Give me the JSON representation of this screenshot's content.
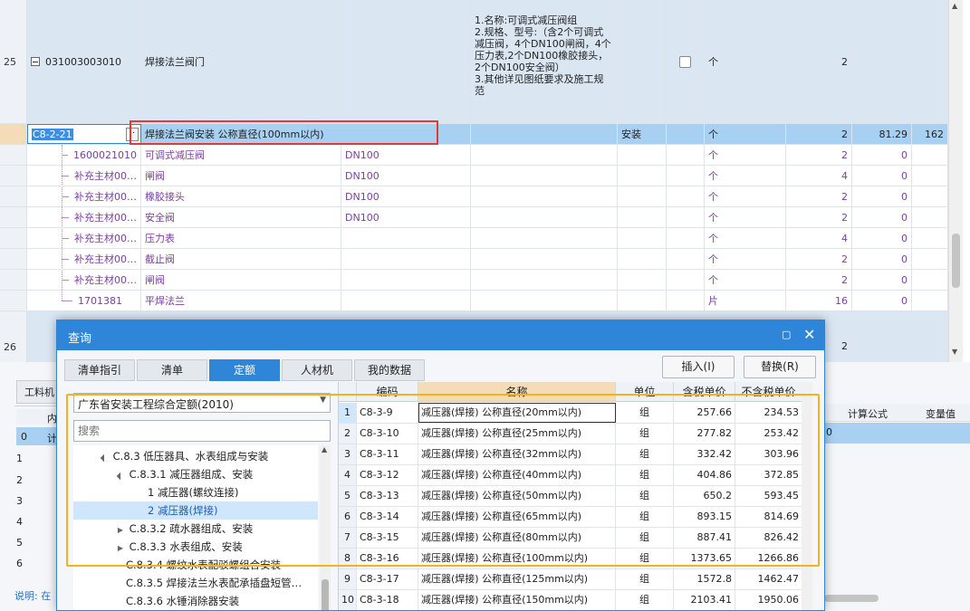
{
  "background": {
    "row25": {
      "no": "25",
      "code": "031003003010",
      "name": "焊接法兰阀门",
      "desc": "1.名称:可调式减压阀组\n2.规格、型号:（含2个可调式减压阀，4个DN100闸阀，4个压力表,2个DN100橡胶接头，2个DN100安全阀）\n3.其他详见图纸要求及施工规范",
      "unit": "个",
      "qty": "2"
    },
    "quota_row": {
      "code": "C8-2-21",
      "name": "焊接法兰阀安装 公称直径(100mm以内)",
      "type": "安装",
      "unit": "个",
      "qty": "2",
      "price": "81.29",
      "total": "162"
    },
    "materials": [
      {
        "code": "1600021010",
        "name": "可调式减压阀",
        "spec": "DN100",
        "unit": "个",
        "qty": "2",
        "v": "0"
      },
      {
        "code": "补充主材00…",
        "name": "闸阀",
        "spec": "DN100",
        "unit": "个",
        "qty": "4",
        "v": "0"
      },
      {
        "code": "补充主材00…",
        "name": "橡胶接头",
        "spec": "DN100",
        "unit": "个",
        "qty": "2",
        "v": "0"
      },
      {
        "code": "补充主材00…",
        "name": "安全阀",
        "spec": "DN100",
        "unit": "个",
        "qty": "2",
        "v": "0"
      },
      {
        "code": "补充主材00…",
        "name": "压力表",
        "spec": "",
        "unit": "个",
        "qty": "4",
        "v": "0"
      },
      {
        "code": "补充主材00…",
        "name": "截止阀",
        "spec": "",
        "unit": "个",
        "qty": "2",
        "v": "0"
      },
      {
        "code": "补充主材00…",
        "name": "闸阀",
        "spec": "",
        "unit": "个",
        "qty": "2",
        "v": "0"
      },
      {
        "code": "1701381",
        "name": "平焊法兰",
        "spec": "",
        "unit": "片",
        "qty": "16",
        "v": "0"
      }
    ],
    "row26": {
      "no": "26",
      "qty": "2"
    },
    "lower": {
      "tab1": "工料机",
      "row_labels": [
        "0",
        "1",
        "2",
        "3",
        "4",
        "5",
        "6"
      ],
      "row0_text": "计",
      "col_head": "内",
      "right_headers": [
        "计算公式",
        "变量值"
      ],
      "right_value": "0",
      "explain": "说明: 在"
    }
  },
  "dialog": {
    "title": "查询",
    "tabs": [
      "清单指引",
      "清单",
      "定额",
      "人材机",
      "我的数据"
    ],
    "active_tab": "定额",
    "insert_button": "插入(I)",
    "replace_button": "替换(R)",
    "library": "广东省安装工程综合定额(2010)",
    "search_placeholder": "搜索",
    "tree": [
      {
        "label": "C.8.3 低压器具、水表组成与安装",
        "toggle": "▲",
        "level": 0
      },
      {
        "label": "C.8.3.1 减压器组成、安装",
        "toggle": "▲",
        "level": 1
      },
      {
        "label": "1 减压器(螺纹连接)",
        "toggle": "",
        "level": 2
      },
      {
        "label": "2 减压器(焊接)",
        "toggle": "",
        "level": 2,
        "selected": true
      },
      {
        "label": "C.8.3.2 疏水器组成、安装",
        "toggle": "▶",
        "level": 1
      },
      {
        "label": "C.8.3.3 水表组成、安装",
        "toggle": "▶",
        "level": 1
      },
      {
        "label": "C.8.3.4 螺纹水表配驳螺组合安装",
        "toggle": "",
        "level": 1
      },
      {
        "label": "C.8.3.5 焊接法兰水表配承插盘短管…",
        "toggle": "",
        "level": 1
      },
      {
        "label": "C.8.3.6 水锤消除器安装",
        "toggle": "",
        "level": 1
      }
    ],
    "table": {
      "headers": [
        "编码",
        "名称",
        "单位",
        "含税单价",
        "不含税单价"
      ],
      "rows": [
        {
          "no": "1",
          "code": "C8-3-9",
          "name": "减压器(焊接) 公称直径(20mm以内)",
          "unit": "组",
          "tax": "257.66",
          "notax": "234.53"
        },
        {
          "no": "2",
          "code": "C8-3-10",
          "name": "减压器(焊接) 公称直径(25mm以内)",
          "unit": "组",
          "tax": "277.82",
          "notax": "253.42"
        },
        {
          "no": "3",
          "code": "C8-3-11",
          "name": "减压器(焊接) 公称直径(32mm以内)",
          "unit": "组",
          "tax": "332.42",
          "notax": "303.96"
        },
        {
          "no": "4",
          "code": "C8-3-12",
          "name": "减压器(焊接) 公称直径(40mm以内)",
          "unit": "组",
          "tax": "404.86",
          "notax": "372.85"
        },
        {
          "no": "5",
          "code": "C8-3-13",
          "name": "减压器(焊接) 公称直径(50mm以内)",
          "unit": "组",
          "tax": "650.2",
          "notax": "593.45"
        },
        {
          "no": "6",
          "code": "C8-3-14",
          "name": "减压器(焊接) 公称直径(65mm以内)",
          "unit": "组",
          "tax": "893.15",
          "notax": "814.69"
        },
        {
          "no": "7",
          "code": "C8-3-15",
          "name": "减压器(焊接) 公称直径(80mm以内)",
          "unit": "组",
          "tax": "887.41",
          "notax": "826.42"
        },
        {
          "no": "8",
          "code": "C8-3-16",
          "name": "减压器(焊接) 公称直径(100mm以内)",
          "unit": "组",
          "tax": "1373.65",
          "notax": "1266.86"
        },
        {
          "no": "9",
          "code": "C8-3-17",
          "name": "减压器(焊接) 公称直径(125mm以内)",
          "unit": "组",
          "tax": "1572.8",
          "notax": "1462.47"
        },
        {
          "no": "10",
          "code": "C8-3-18",
          "name": "减压器(焊接) 公称直径(150mm以内)",
          "unit": "组",
          "tax": "2103.41",
          "notax": "1950.06"
        }
      ]
    }
  }
}
